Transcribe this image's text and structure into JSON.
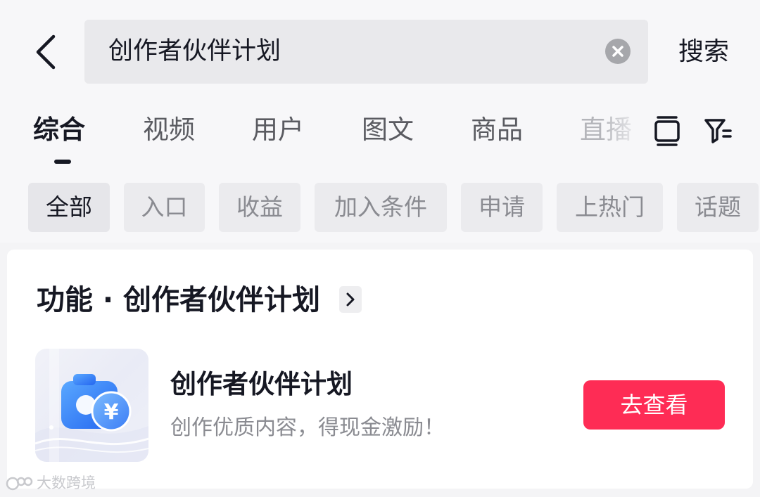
{
  "search": {
    "value": "创作者伙伴计划",
    "submit_label": "搜索"
  },
  "tabs": [
    {
      "label": "综合",
      "active": true
    },
    {
      "label": "视频"
    },
    {
      "label": "用户"
    },
    {
      "label": "图文"
    },
    {
      "label": "商品"
    },
    {
      "label": "直播"
    }
  ],
  "toolbar_icons": [
    "layout-toggle-icon",
    "filter-icon"
  ],
  "chips": [
    {
      "label": "全部",
      "active": true
    },
    {
      "label": "入口"
    },
    {
      "label": "收益"
    },
    {
      "label": "加入条件"
    },
    {
      "label": "申请"
    },
    {
      "label": "上热门"
    },
    {
      "label": "话题"
    }
  ],
  "result_card": {
    "section_title": "功能 · 创作者伙伴计划",
    "item": {
      "name": "创作者伙伴计划",
      "description": "创作优质内容，得现金激励！",
      "button_label": "去查看",
      "icon_glyph": "¥"
    }
  },
  "watermark": {
    "text": "大数跨境"
  },
  "colors": {
    "accent": "#fe2c55",
    "icon_blue": "#2f7cf6"
  }
}
